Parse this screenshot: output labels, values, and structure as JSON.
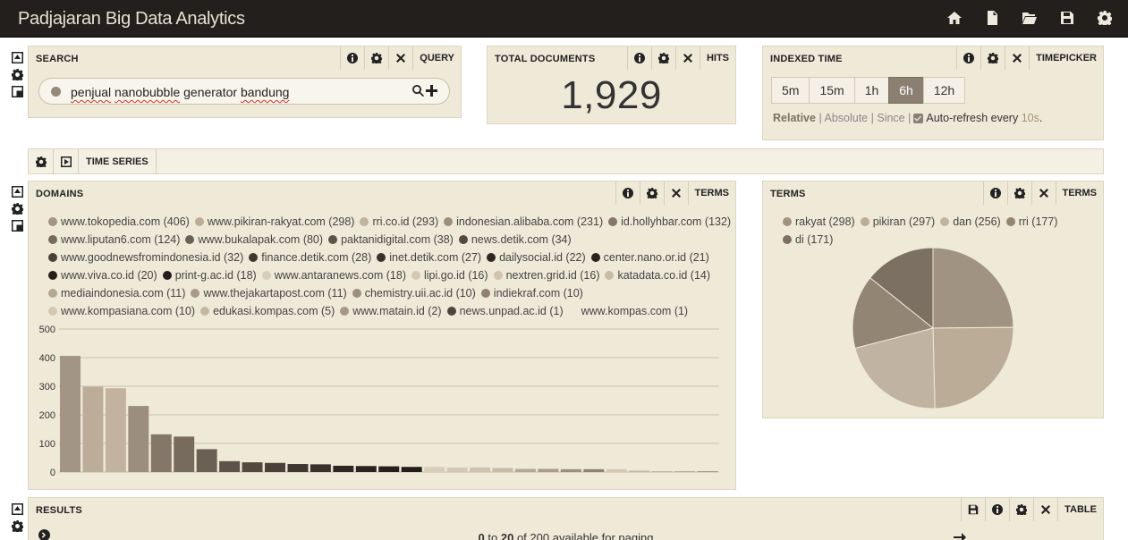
{
  "app": {
    "title": "Padjajaran Big Data Analytics",
    "nav_icons": [
      "home-icon",
      "new-dashboard-icon",
      "open-folder-icon",
      "save-icon",
      "settings-icon"
    ]
  },
  "search": {
    "title": "SEARCH",
    "tab": "QUERY",
    "query": "penjual nanobubble generator bandung",
    "query_words": [
      {
        "w": "penjual",
        "spell": true
      },
      {
        "w": "nanobubble",
        "spell": true
      },
      {
        "w": "generator",
        "spell": false
      },
      {
        "w": "bandung",
        "spell": true
      }
    ]
  },
  "total": {
    "title": "TOTAL DOCUMENTS",
    "tab": "HITS",
    "value": "1,929"
  },
  "timepicker": {
    "title": "INDEXED TIME",
    "tab": "TIMEPICKER",
    "buttons": [
      "5m",
      "15m",
      "1h",
      "6h",
      "12h"
    ],
    "active": "6h",
    "mode_relative": "Relative",
    "mode_absolute": "Absolute",
    "mode_since": "Since",
    "sep": "|",
    "refresh_label": "Auto-refresh every",
    "refresh_value": "10s",
    "period": "."
  },
  "timeseries": {
    "title": "TIME SERIES"
  },
  "domains": {
    "title": "DOMAINS",
    "tab": "TERMS"
  },
  "terms": {
    "title": "TERMS",
    "tab": "TERMS"
  },
  "results": {
    "title": "RESULTS",
    "tab": "TABLE",
    "from": "0",
    "to_word": "to",
    "to": "20",
    "suffix": "of 200 available for paging"
  },
  "chart_data": [
    {
      "type": "bar",
      "title": "",
      "colors": [
        "#a39585",
        "#bcad99",
        "#c1b39e",
        "#9c8e7e",
        "#847769",
        "#776b5e",
        "#6b6054",
        "#5d5349",
        "#54493f",
        "#4a4037",
        "#403630",
        "#3a312b",
        "#2f2722",
        "#2a221d",
        "#26201b",
        "#231c18",
        "#d8cdb8",
        "#d4c9b4",
        "#cfc3ad",
        "#c8bca6",
        "#b4a794",
        "#a89b89",
        "#9d8f7f",
        "#8e8174",
        "#d4c8b2",
        "#c5b8a3",
        "#a6998a",
        "#4d443c"
      ],
      "categories": [
        "www.tokopedia.com",
        "www.pikiran-rakyat.com",
        "rri.co.id",
        "indonesian.alibaba.com",
        "id.hollyhbar.com",
        "www.liputan6.com",
        "www.bukalapak.com",
        "paktanidigital.com",
        "news.detik.com",
        "www.goodnewsfromindonesia.id",
        "finance.detik.com",
        "inet.detik.com",
        "dailysocial.id",
        "center.nano.or.id",
        "www.viva.co.id",
        "print-g.ac.id",
        "www.antaranews.com",
        "lipi.go.id",
        "nextren.grid.id",
        "katadata.co.id",
        "mediaindonesia.com",
        "www.thejakartapost.com",
        "chemistry.uii.ac.id",
        "indiekraf.com",
        "www.kompasiana.com",
        "edukasi.kompas.com",
        "www.matain.id",
        "news.unpad.ac.id",
        "www.kompas.com"
      ],
      "values": [
        406,
        298,
        293,
        231,
        132,
        124,
        80,
        38,
        34,
        32,
        28,
        27,
        22,
        21,
        20,
        18,
        18,
        16,
        16,
        14,
        11,
        11,
        10,
        10,
        10,
        5,
        2,
        1,
        1
      ],
      "ylim": [
        0,
        500
      ],
      "yticks": [
        0,
        100,
        200,
        300,
        400,
        500
      ],
      "grid": true
    },
    {
      "type": "pie",
      "title": "",
      "categories": [
        "rakyat",
        "pikiran",
        "dan",
        "rri",
        "di"
      ],
      "values": [
        298,
        297,
        256,
        177,
        171
      ],
      "colors": [
        "#a09381",
        "#bbac97",
        "#c0b3a1",
        "#928574",
        "#7c7063"
      ]
    }
  ]
}
